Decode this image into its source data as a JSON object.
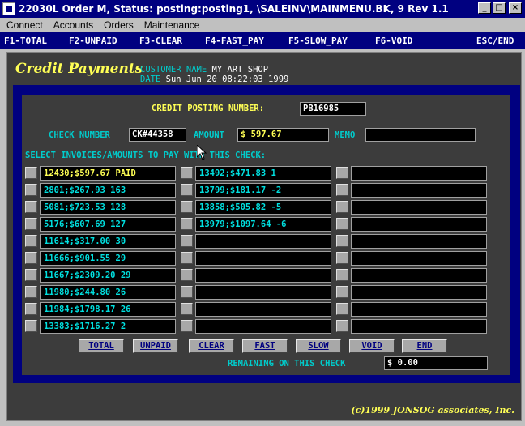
{
  "window": {
    "title": "22030L Order M, Status: posting:posting1, \\SALEINV\\MAINMENU.BK, 9 Rev 1.1",
    "minimize": "_",
    "maximize": "□",
    "close": "×"
  },
  "menu": [
    "Connect",
    "Accounts",
    "Orders",
    "Maintenance"
  ],
  "fkeys": [
    "F1-TOTAL",
    "F2-UNPAID",
    "F3-CLEAR",
    "F4-FAST_PAY",
    "F5-SLOW_PAY",
    "F6-VOID",
    "ESC/END"
  ],
  "screen": {
    "heading": "Credit Payments",
    "customer_label": "CUSTOMER NAME",
    "customer_value": "MY ART SHOP",
    "date_label": "DATE",
    "date_value": "Sun Jun 20 08:22:03 1999",
    "posting_label": "CREDIT POSTING NUMBER:",
    "posting_value": "PB16985",
    "check_label": "CHECK NUMBER",
    "check_value": "CK#44358",
    "amount_label": "AMOUNT",
    "amount_value": "$    597.67",
    "memo_label": "MEMO",
    "memo_value": "",
    "select_label": "SELECT INVOICES/AMOUNTS TO PAY WITH THIS CHECK:",
    "invoices_col1": [
      "12430;$597.67 PAID",
      "2801;$267.93 163",
      "5081;$723.53 128",
      "5176;$607.69 127",
      "11614;$317.00 30",
      "11666;$901.55 29",
      "11667;$2309.20 29",
      "11980;$244.80 26",
      "11984;$1798.17 26",
      "13383;$1716.27 2"
    ],
    "invoices_col2": [
      "13492;$471.83 1",
      "13799;$181.17 -2",
      "13858;$505.82 -5",
      "13979;$1097.64 -6",
      "",
      "",
      "",
      "",
      "",
      ""
    ],
    "invoices_col3": [
      "",
      "",
      "",
      "",
      "",
      "",
      "",
      "",
      "",
      ""
    ],
    "buttons": [
      "TOTAL",
      "UNPAID",
      "CLEAR",
      "FAST",
      "SLOW",
      "VOID",
      "END"
    ],
    "remaining_label": "REMAINING ON THIS CHECK",
    "remaining_value": "$        0.00",
    "copyright": "(c)1999 JONSOG associates, Inc."
  },
  "colors": {
    "title_bg": "#000080",
    "screen_bg": "#3c3c3c",
    "frame_blue": "#000080",
    "label_yellow": "#ffff55",
    "label_cyan": "#00cccc"
  }
}
